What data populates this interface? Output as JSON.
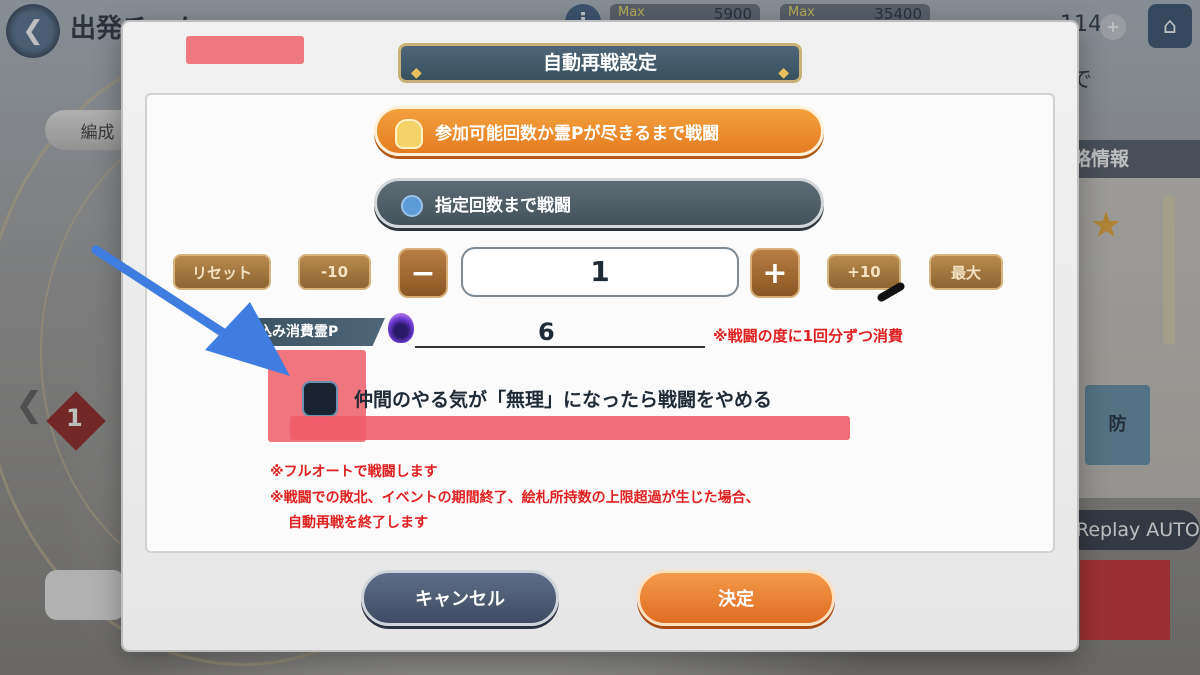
{
  "topbar": {
    "title": "出発チーム",
    "resource1": {
      "max_label": "Max",
      "max": "5900"
    },
    "resource2": {
      "max_label": "Max",
      "max": "35400"
    },
    "count": "114",
    "plus": "+"
  },
  "background": {
    "formation_button": "編成",
    "side_text": "で",
    "side_header": "略情報",
    "card_text": "防",
    "replay_button": "Replay AUTO",
    "rank": "1"
  },
  "modal": {
    "title": "自動再戦設定",
    "mode_options": [
      {
        "label": "参加可能回数か霊Pが尽きるまで戦闘",
        "selected": true
      },
      {
        "label": "指定回数まで戦闘",
        "selected": false
      }
    ],
    "stepper": {
      "reset": "リセット",
      "minus10": "-10",
      "minus": "−",
      "value": "1",
      "plus": "+",
      "plus10": "+10",
      "max": "最大"
    },
    "cost": {
      "label": "見込み消費霊P",
      "value": "6",
      "note": "※戦闘の度に1回分ずつ消費"
    },
    "checkbox": {
      "label": "仲間のやる気が「無理」になったら戦闘をやめる",
      "checked": false
    },
    "notes": [
      "※フルオートで戦闘します",
      "※戦闘での敗北、イベントの期間終了、絵札所持数の上限超過が生じた場合、",
      "自動再戦を終了します"
    ],
    "buttons": {
      "cancel": "キャンセル",
      "confirm": "決定"
    }
  },
  "colors": {
    "accent_orange": "#e47d22",
    "cancel_blue": "#4f5d77",
    "warning_red": "#e02020",
    "annotation_arrow": "#3f7de0",
    "redaction": "#ef5d68"
  }
}
